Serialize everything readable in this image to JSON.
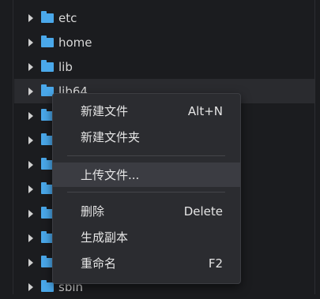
{
  "tree": {
    "rows": [
      {
        "label": "etc"
      },
      {
        "label": "home"
      },
      {
        "label": "lib"
      },
      {
        "label": "lib64"
      },
      {
        "label": ""
      },
      {
        "label": ""
      },
      {
        "label": ""
      },
      {
        "label": ""
      },
      {
        "label": ""
      },
      {
        "label": ""
      },
      {
        "label": ""
      },
      {
        "label": "sbin"
      }
    ]
  },
  "context_menu": {
    "items": [
      {
        "label": "新建文件",
        "shortcut": "Alt+N"
      },
      {
        "label": "新建文件夹",
        "shortcut": ""
      },
      {
        "label": "上传文件...",
        "shortcut": ""
      },
      {
        "label": "删除",
        "shortcut": "Delete"
      },
      {
        "label": "生成副本",
        "shortcut": ""
      },
      {
        "label": "重命名",
        "shortcut": "F2"
      }
    ]
  },
  "colors": {
    "background": "#1b1c1f",
    "menu_background": "#2b2c30",
    "menu_hover": "#3b3c42",
    "folder_icon": "#4aa8ea"
  }
}
